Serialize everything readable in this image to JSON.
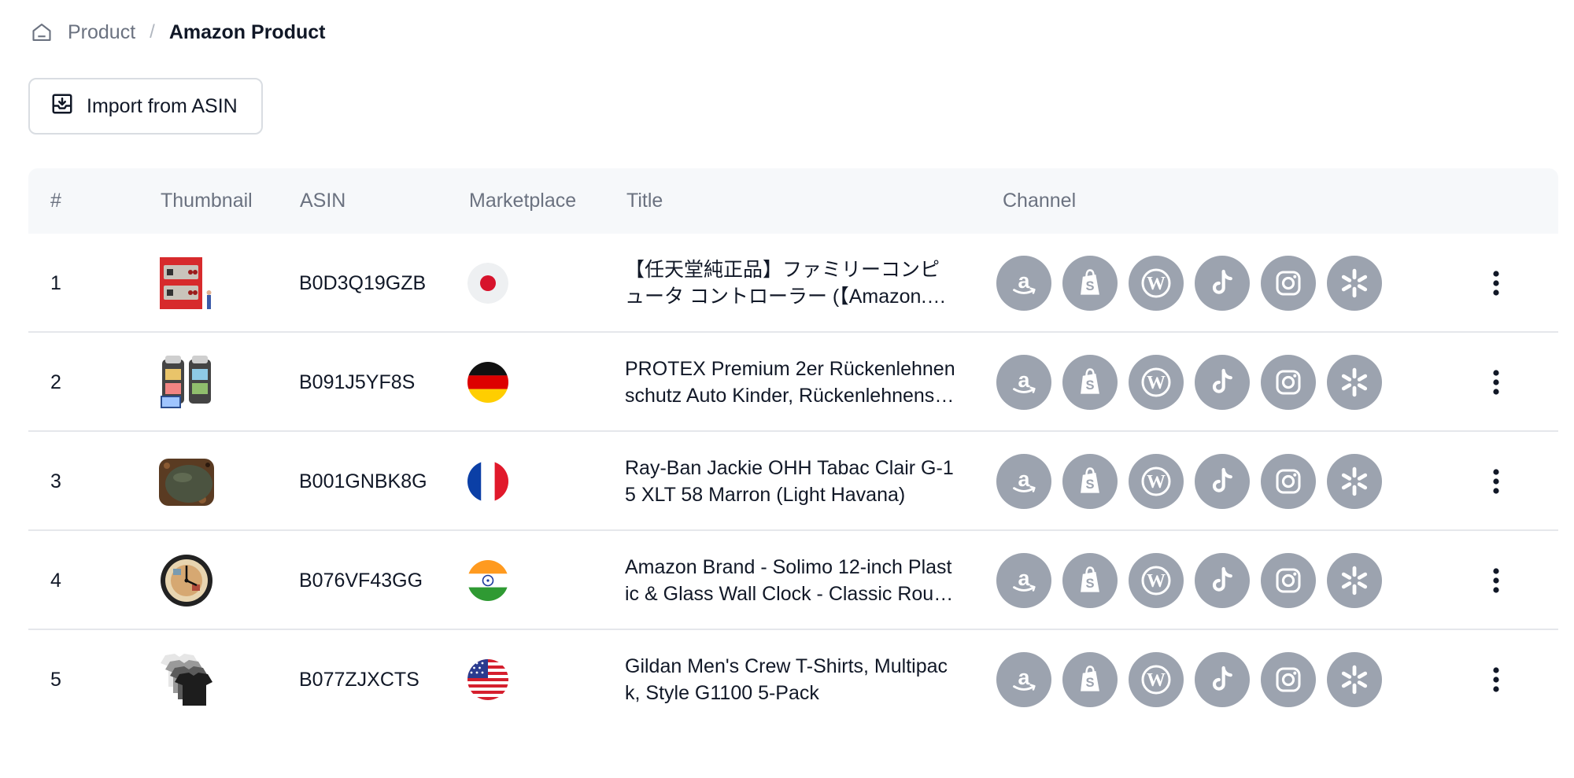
{
  "breadcrumb": {
    "home_icon": "home-icon",
    "parent": "Product",
    "separator": "/",
    "current": "Amazon Product"
  },
  "toolbar": {
    "import_label": "Import from ASIN",
    "import_icon": "import-tray-icon"
  },
  "table": {
    "columns": [
      "#",
      "Thumbnail",
      "ASIN",
      "Marketplace",
      "Title",
      "Channel"
    ],
    "channel_icons": [
      "amazon-icon",
      "shopify-icon",
      "wordpress-icon",
      "tiktok-icon",
      "instagram-icon",
      "walmart-icon"
    ],
    "channel_color": "#9ca3af",
    "rows": [
      {
        "num": "1",
        "asin": "B0D3Q19GZB",
        "marketplace": "Japan",
        "flag_icon": "flag-jp-icon",
        "title": "【任天堂純正品】ファミリーコンピュータ コントローラー (【Amazon.co.jp限定】",
        "thumbnail": "nes-controller-thumbnail"
      },
      {
        "num": "2",
        "asin": "B091J5YF8S",
        "marketplace": "Germany",
        "flag_icon": "flag-de-icon",
        "title": "PROTEX Premium 2er Rückenlehnenschutz Auto Kinder, Rückenlehnenschutz mit Tablet Fach",
        "thumbnail": "seat-organizer-thumbnail"
      },
      {
        "num": "3",
        "asin": "B001GNBK8G",
        "marketplace": "France",
        "flag_icon": "flag-fr-icon",
        "title": "Ray-Ban Jackie OHH Tabac Clair G-15 XLT 58 Marron (Light Havana)",
        "thumbnail": "sunglasses-thumbnail"
      },
      {
        "num": "4",
        "asin": "B076VF43GG",
        "marketplace": "India",
        "flag_icon": "flag-in-icon",
        "title": "Amazon Brand - Solimo 12-inch Plastic & Glass Wall Clock - Classic Roulette",
        "thumbnail": "wall-clock-thumbnail"
      },
      {
        "num": "5",
        "asin": "B077ZJXCTS",
        "marketplace": "United States",
        "flag_icon": "flag-us-icon",
        "title": "Gildan Men's Crew T-Shirts, Multipack, Style G1100 5-Pack",
        "thumbnail": "tshirts-thumbnail"
      }
    ]
  }
}
